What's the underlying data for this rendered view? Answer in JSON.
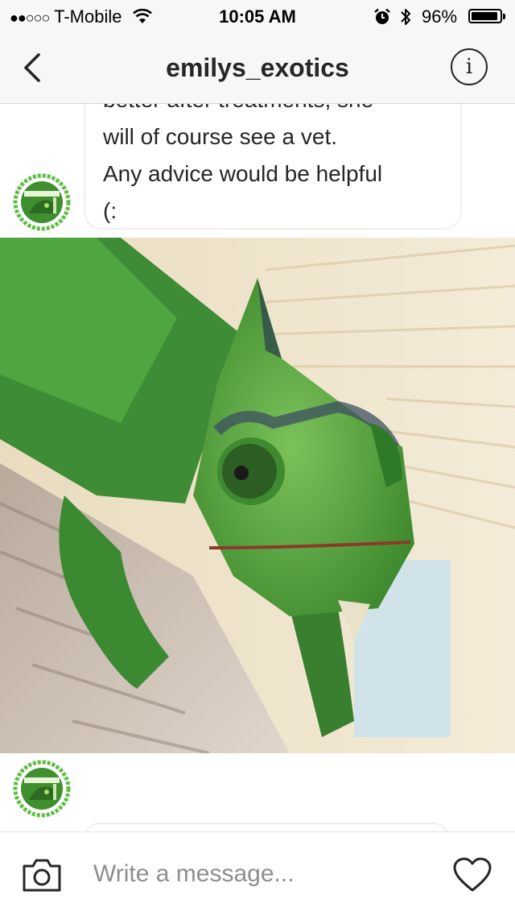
{
  "status_bar": {
    "signal_dots": "●●○○○",
    "carrier": "T-Mobile",
    "time": "10:05 AM",
    "battery_percent": "96%",
    "battery_level": 0.96,
    "icons": [
      "wifi-icon",
      "alarm-icon",
      "bluetooth-icon",
      "battery-icon"
    ]
  },
  "header": {
    "title": "emilys_exotics",
    "back_icon": "chevron-left-icon",
    "info_icon": "info-icon",
    "info_glyph": "i"
  },
  "conversation": {
    "message_lines": [
      "better after treatments, she",
      "will of course see a vet.",
      "Any advice would be helpful",
      "(:"
    ],
    "image_subject": "chameleon-photo"
  },
  "composer": {
    "placeholder": "Write a message...",
    "camera_icon": "camera-icon",
    "like_icon": "heart-icon"
  },
  "colors": {
    "bar_background": "#f7f7f7",
    "text": "#262626",
    "placeholder": "#8e8e8e",
    "bubble_border": "#efefef",
    "avatar_green": "#4caf3a"
  }
}
